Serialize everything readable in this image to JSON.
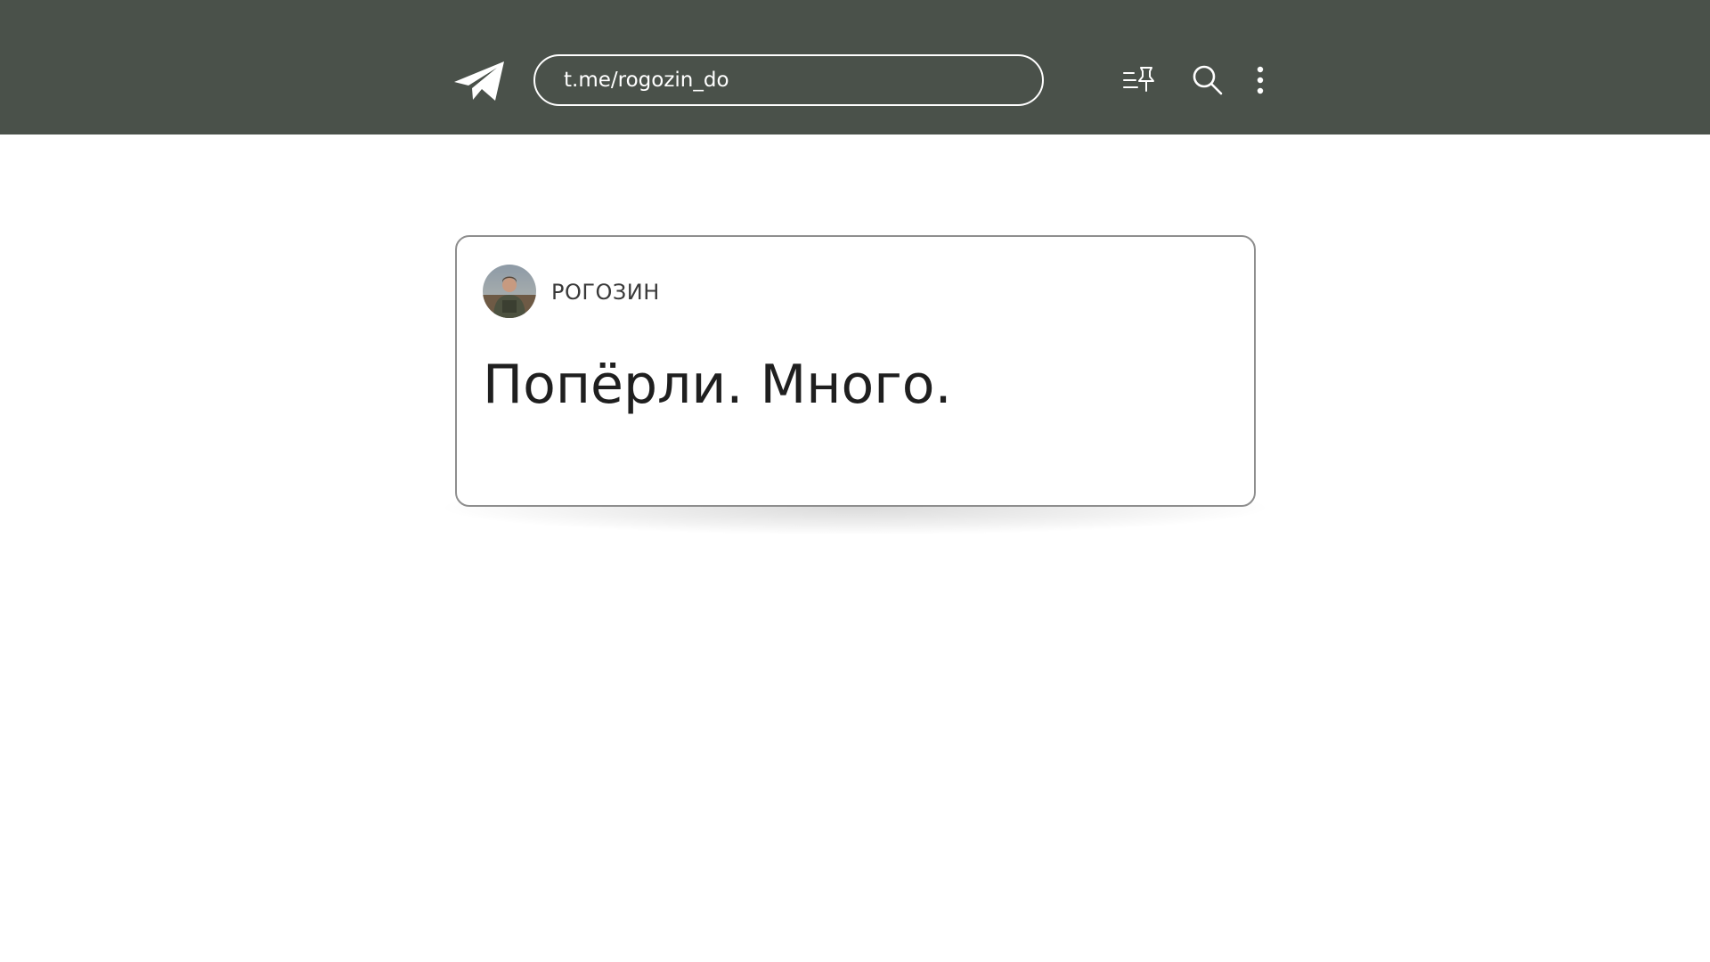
{
  "header": {
    "url": "t.me/rogozin_do",
    "background_color": "#4a514a",
    "icons": {
      "logo": "telegram-icon",
      "pinned": "pinned-list-icon",
      "search": "search-icon",
      "more": "more-vertical-icon"
    }
  },
  "post": {
    "channel_name": "РОГОЗИН",
    "text": "Попёрли. Много."
  }
}
